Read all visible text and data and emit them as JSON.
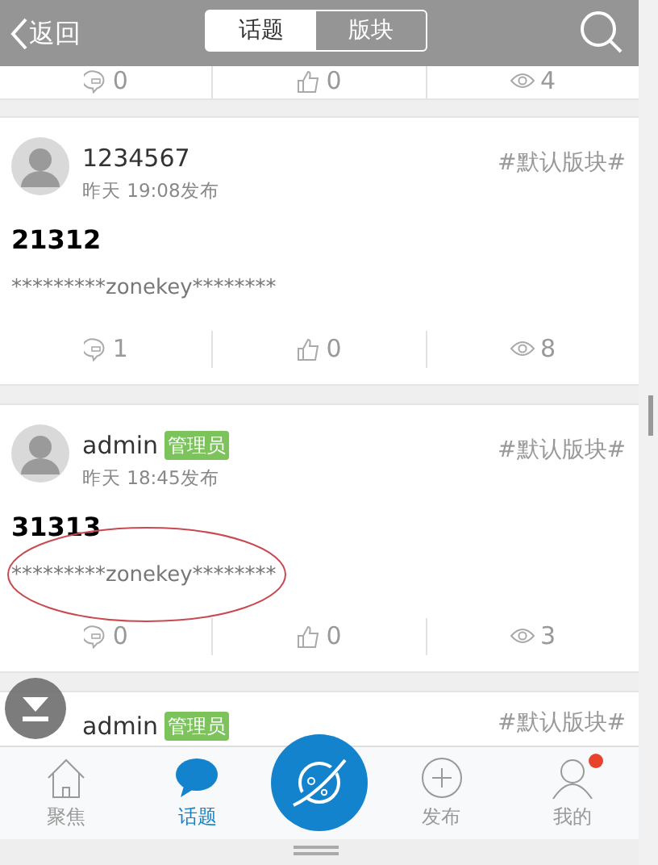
{
  "header": {
    "back": "返回",
    "tabs": [
      {
        "label": "话题",
        "selected": true
      },
      {
        "label": "版块",
        "selected": false
      }
    ]
  },
  "top_stats": {
    "comments": "0",
    "likes": "0",
    "views": "4"
  },
  "posts": [
    {
      "user": "1234567",
      "time": "昨天 19:08发布",
      "board": "#默认版块#",
      "title": "21312",
      "body": "*********zonekey********",
      "stats": {
        "comments": "1",
        "likes": "0",
        "views": "8"
      },
      "circled": false
    },
    {
      "user": "admin",
      "badge": "管理员",
      "time": "昨天 18:45发布",
      "board": "#默认版块#",
      "title": "31313",
      "body": "*********zonekey********",
      "stats": {
        "comments": "0",
        "likes": "0",
        "views": "3"
      },
      "circled": true
    },
    {
      "user": "admin",
      "badge": "管理员",
      "board": "#默认版块#"
    }
  ],
  "tabbar": [
    {
      "kind": "home",
      "label": "聚焦",
      "selected": false
    },
    {
      "kind": "chat",
      "label": "话题",
      "selected": true
    },
    {
      "kind": "center"
    },
    {
      "kind": "plus",
      "label": "发布",
      "selected": false
    },
    {
      "kind": "user",
      "label": "我的",
      "selected": false,
      "notification": true
    }
  ]
}
